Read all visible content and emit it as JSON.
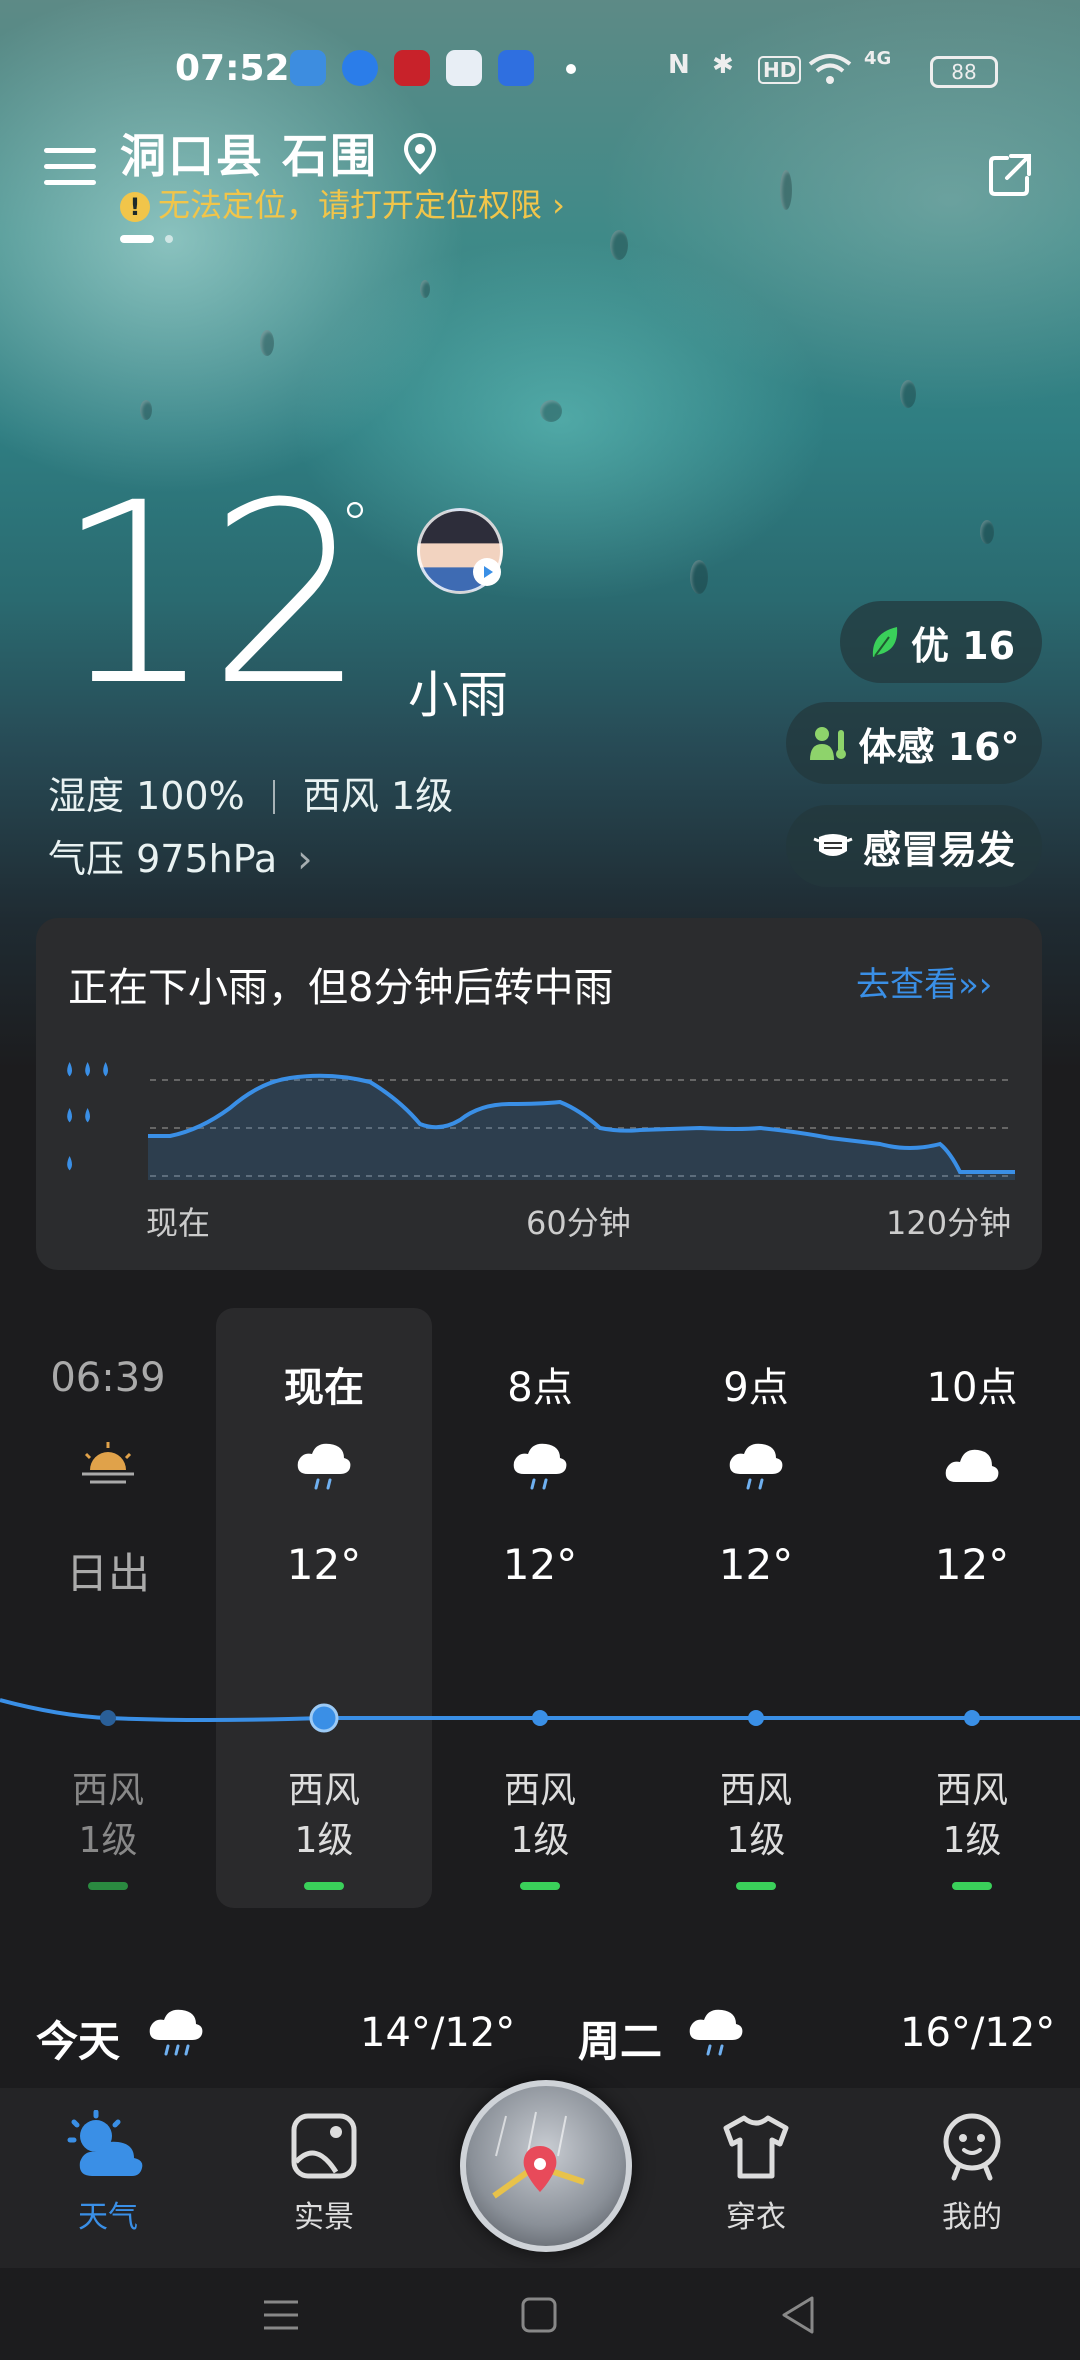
{
  "status_bar": {
    "time": "07:52",
    "nfc": "N",
    "bluetooth": "✱",
    "hd": "HD",
    "network": "4G",
    "battery": "88"
  },
  "header": {
    "location": "洞口县 石围",
    "warning": "无法定位，请打开定位权限 ›"
  },
  "current": {
    "temp": "12",
    "degree_symbol": "°",
    "condition": "小雨",
    "humidity": "湿度 100%",
    "wind": "西风 1级",
    "pressure": "气压 975hPa",
    "pressure_arrow": "›"
  },
  "chips": {
    "aqi": "优 16",
    "feels": "体感 16°",
    "cold": "感冒易发"
  },
  "rain_card": {
    "title": "正在下小雨，但8分钟后转中雨",
    "link": "去查看",
    "link_arrows": "»›",
    "x_labels": [
      "现在",
      "60分钟",
      "120分钟"
    ]
  },
  "hourly": [
    {
      "time": "06:39",
      "label": "日出",
      "icon": "sunrise-icon",
      "wind": "西风",
      "level": "1级"
    },
    {
      "time": "现在",
      "temp": "12°",
      "icon": "rain-cloud-icon",
      "wind": "西风",
      "level": "1级"
    },
    {
      "time": "8点",
      "temp": "12°",
      "icon": "rain-cloud-icon",
      "wind": "西风",
      "level": "1级"
    },
    {
      "time": "9点",
      "temp": "12°",
      "icon": "rain-cloud-icon",
      "wind": "西风",
      "level": "1级"
    },
    {
      "time": "10点",
      "temp": "12°",
      "icon": "cloud-icon",
      "wind": "西风",
      "level": "1级"
    }
  ],
  "daily": [
    {
      "day": "今天",
      "icon": "rain-cloud-icon",
      "temps": "14°/12°"
    },
    {
      "day": "周二",
      "icon": "rain-cloud-icon",
      "temps": "16°/12°"
    }
  ],
  "bottom_nav": {
    "weather": "天气",
    "scene": "实景",
    "clothing": "穿衣",
    "mine": "我的"
  },
  "colors": {
    "accent": "#3a8fe6",
    "warning": "#f1c54a",
    "wind_bar": "#3ad05a",
    "aqi_leaf": "#3ad05a"
  }
}
